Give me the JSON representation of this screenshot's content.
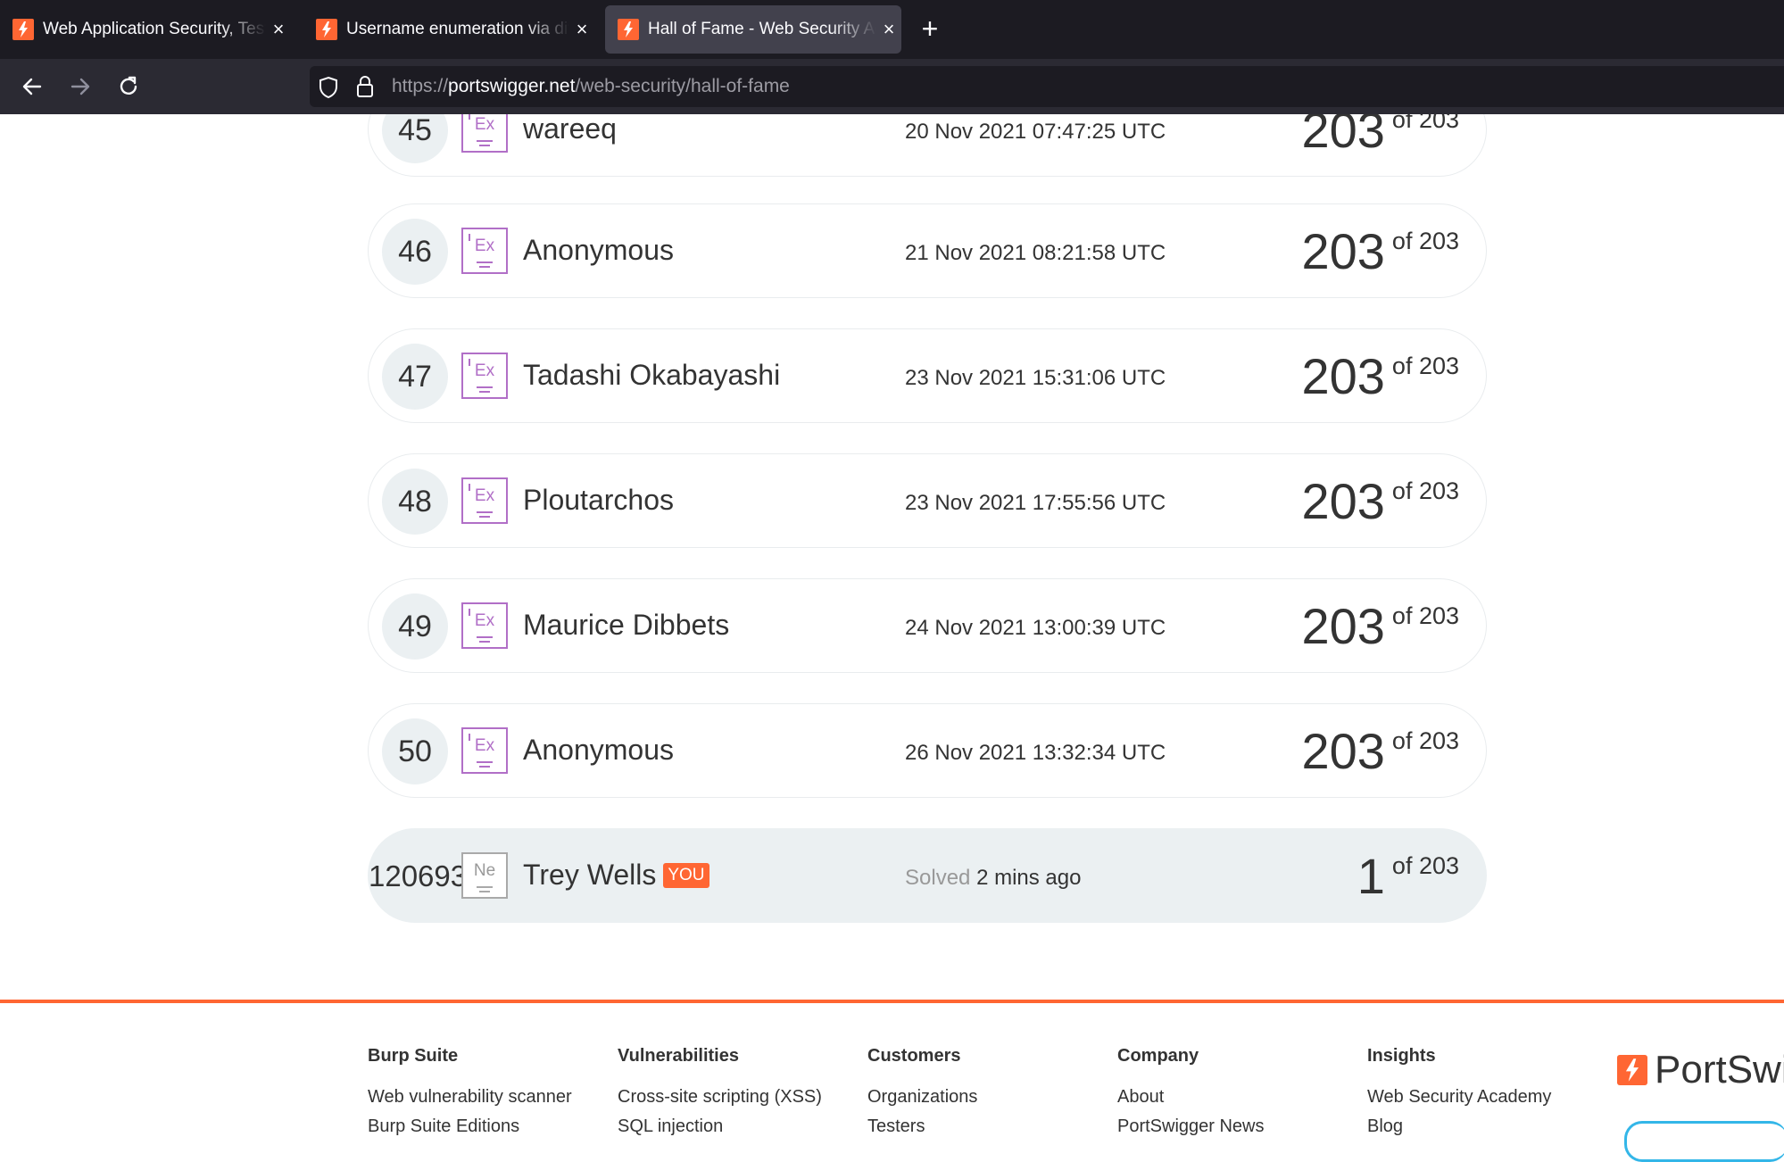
{
  "browser": {
    "tabs": [
      {
        "title": "Web Application Security, Testing, & Scanning - PortSwigger",
        "active": false
      },
      {
        "title": "Username enumeration via different responses",
        "active": false
      },
      {
        "title": "Hall of Fame - Web Security Academy",
        "active": true
      }
    ],
    "url": {
      "scheme": "https://",
      "host": "portswigger.net",
      "path": "/web-security/hall-of-fame"
    }
  },
  "leaderboard": {
    "rows": [
      {
        "rank": "45",
        "badge": "Ex",
        "name": "wareeq",
        "date": "20 Nov 2021 07:47:25 UTC",
        "score": "203",
        "of": "of 203"
      },
      {
        "rank": "46",
        "badge": "Ex",
        "name": "Anonymous",
        "date": "21 Nov 2021 08:21:58 UTC",
        "score": "203",
        "of": "of 203"
      },
      {
        "rank": "47",
        "badge": "Ex",
        "name": "Tadashi Okabayashi",
        "date": "23 Nov 2021 15:31:06 UTC",
        "score": "203",
        "of": "of 203"
      },
      {
        "rank": "48",
        "badge": "Ex",
        "name": "Ploutarchos",
        "date": "23 Nov 2021 17:55:56 UTC",
        "score": "203",
        "of": "of 203"
      },
      {
        "rank": "49",
        "badge": "Ex",
        "name": "Maurice Dibbets",
        "date": "24 Nov 2021 13:00:39 UTC",
        "score": "203",
        "of": "of 203"
      },
      {
        "rank": "50",
        "badge": "Ex",
        "name": "Anonymous",
        "date": "26 Nov 2021 13:32:34 UTC",
        "score": "203",
        "of": "of 203"
      }
    ],
    "current_user": {
      "rank": "120693",
      "badge": "Ne",
      "name": "Trey Wells",
      "tag": "YOU",
      "solved_label": "Solved",
      "solved_time": "2 mins ago",
      "score": "1",
      "of": "of 203"
    }
  },
  "footer": {
    "columns": [
      {
        "heading": "Burp Suite",
        "links": [
          "Web vulnerability scanner",
          "Burp Suite Editions"
        ]
      },
      {
        "heading": "Vulnerabilities",
        "links": [
          "Cross-site scripting (XSS)",
          "SQL injection"
        ]
      },
      {
        "heading": "Customers",
        "links": [
          "Organizations",
          "Testers"
        ]
      },
      {
        "heading": "Company",
        "links": [
          "About",
          "PortSwigger News"
        ]
      },
      {
        "heading": "Insights",
        "links": [
          "Web Security Academy",
          "Blog"
        ]
      }
    ],
    "logo_text": "PortSwigger"
  },
  "colors": {
    "brand_orange": "#ff6633",
    "badge_expert": "#b16fc7",
    "chrome_dark": "#1c1b22"
  },
  "icons": [
    "portswigger-favicon",
    "close-icon",
    "plus-icon",
    "back-arrow-icon",
    "forward-arrow-icon",
    "reload-icon",
    "shield-icon",
    "lock-icon"
  ]
}
